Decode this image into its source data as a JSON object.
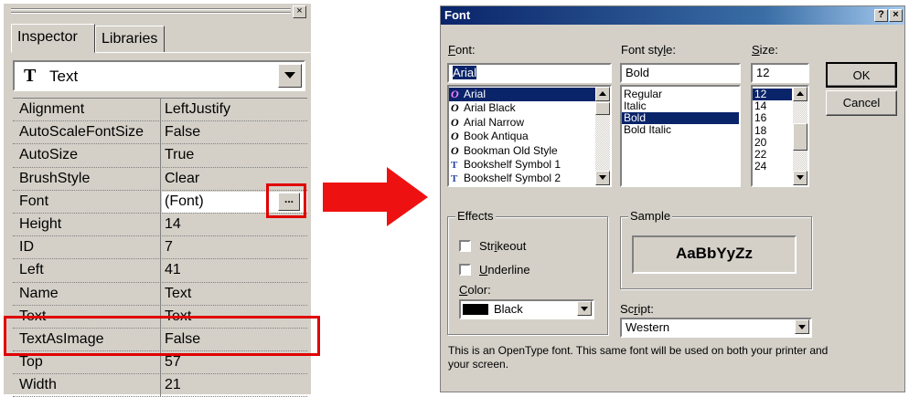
{
  "inspector": {
    "close_glyph": "×",
    "tabs": [
      {
        "label": "Inspector",
        "active": true
      },
      {
        "label": "Libraries",
        "active": false
      }
    ],
    "object_selector": {
      "icon": "T",
      "value": "Text"
    },
    "properties": [
      {
        "name": "Alignment",
        "value": "LeftJustify"
      },
      {
        "name": "AutoScaleFontSize",
        "value": "False"
      },
      {
        "name": "AutoSize",
        "value": "True"
      },
      {
        "name": "BrushStyle",
        "value": "Clear"
      },
      {
        "name": "Font",
        "value": "(Font)"
      },
      {
        "name": "Height",
        "value": "14"
      },
      {
        "name": "ID",
        "value": "7"
      },
      {
        "name": "Left",
        "value": "41"
      },
      {
        "name": "Name",
        "value": "Text"
      },
      {
        "name": "Text",
        "value": "Text"
      },
      {
        "name": "TextAsImage",
        "value": "False"
      },
      {
        "name": "Top",
        "value": "57"
      },
      {
        "name": "Width",
        "value": "21"
      }
    ],
    "ellipsis_label": "...",
    "highlight_color": "#e00000"
  },
  "arrow_color": "#ee1111",
  "font_dialog": {
    "title": "Font",
    "help_glyph": "?",
    "close_glyph": "×",
    "font_label": "Font:",
    "font_value": "Arial",
    "fonts": [
      {
        "name": "Arial",
        "icon": "O",
        "icon_type": "opentype-icon",
        "selected": true
      },
      {
        "name": "Arial Black",
        "icon": "O",
        "icon_type": "opentype-icon",
        "selected": false
      },
      {
        "name": "Arial Narrow",
        "icon": "O",
        "icon_type": "opentype-icon",
        "selected": false
      },
      {
        "name": "Book Antiqua",
        "icon": "O",
        "icon_type": "opentype-icon",
        "selected": false
      },
      {
        "name": "Bookman Old Style",
        "icon": "O",
        "icon_type": "opentype-icon",
        "selected": false
      },
      {
        "name": "Bookshelf Symbol 1",
        "icon": "T",
        "icon_type": "truetype-icon",
        "selected": false
      },
      {
        "name": "Bookshelf Symbol 2",
        "icon": "T",
        "icon_type": "truetype-icon",
        "selected": false
      }
    ],
    "style_label": "Font style:",
    "style_value": "Bold",
    "styles": [
      {
        "name": "Regular",
        "selected": false
      },
      {
        "name": "Italic",
        "selected": false
      },
      {
        "name": "Bold",
        "selected": true
      },
      {
        "name": "Bold Italic",
        "selected": false
      }
    ],
    "size_label": "Size:",
    "size_value": "12",
    "sizes": [
      {
        "name": "12",
        "selected": true
      },
      {
        "name": "14",
        "selected": false
      },
      {
        "name": "16",
        "selected": false
      },
      {
        "name": "18",
        "selected": false
      },
      {
        "name": "20",
        "selected": false
      },
      {
        "name": "22",
        "selected": false
      },
      {
        "name": "24",
        "selected": false
      }
    ],
    "ok_label": "OK",
    "cancel_label": "Cancel",
    "effects": {
      "title": "Effects",
      "strikeout_label": "Strikeout",
      "strikeout_checked": false,
      "underline_label": "Underline",
      "underline_checked": false,
      "color_label": "Color:",
      "color_value": "Black",
      "color_swatch": "#000000"
    },
    "sample": {
      "title": "Sample",
      "text": "AaBbYyZz"
    },
    "script_label": "Script:",
    "script_value": "Western",
    "info_text": "This is an OpenType font. This same font will be used on both your printer and your screen."
  }
}
